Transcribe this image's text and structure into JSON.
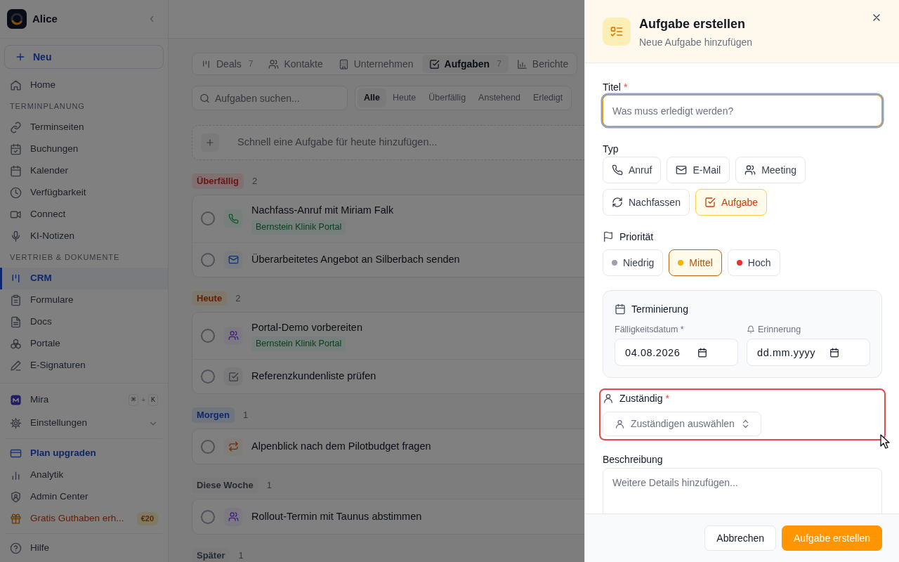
{
  "sidebar": {
    "workspace": "Alice",
    "new_button": "Neu",
    "nav": [
      {
        "kind": "home",
        "label": "Home",
        "selected": false
      },
      {
        "kind": "heading",
        "label": "TERMINPLANUNG"
      },
      {
        "kind": "link",
        "label": "Terminseiten",
        "selected": false
      },
      {
        "kind": "bookings",
        "label": "Buchungen",
        "selected": false
      },
      {
        "kind": "calendar",
        "label": "Kalender",
        "selected": false
      },
      {
        "kind": "clock",
        "label": "Verfügbarkeit",
        "selected": false
      },
      {
        "kind": "video",
        "label": "Connect",
        "selected": false
      },
      {
        "kind": "mic",
        "label": "KI-Notizen",
        "selected": false
      },
      {
        "kind": "heading",
        "label": "VERTRIEB & DOKUMENTE"
      },
      {
        "kind": "crm",
        "label": "CRM",
        "selected": true
      },
      {
        "kind": "forms",
        "label": "Formulare",
        "selected": false
      },
      {
        "kind": "docs",
        "label": "Docs",
        "selected": false
      },
      {
        "kind": "portals",
        "label": "Portale",
        "selected": false
      },
      {
        "kind": "signatures",
        "label": "E-Signaturen",
        "selected": false
      }
    ],
    "bottom_groups": [
      [
        {
          "kind": "assistant",
          "label": "Mira",
          "keys": [
            "⌘",
            "K"
          ],
          "key_joiner": "+"
        },
        {
          "kind": "expander",
          "label": "Einstellungen",
          "expanded": false
        }
      ],
      [
        {
          "kind": "accent",
          "label": "Plan upgraden"
        },
        {
          "kind": "plain",
          "label": "Analytik"
        },
        {
          "kind": "plain",
          "label": "Admin Center"
        },
        {
          "kind": "reward",
          "label": "Gratis Guthaben erh...",
          "badge": "€20"
        }
      ],
      [
        {
          "kind": "plain",
          "label": "Hilfe"
        }
      ]
    ]
  },
  "main": {
    "tabs": [
      {
        "label": "Deals",
        "count": "7",
        "selected": false
      },
      {
        "label": "Kontakte",
        "selected": false
      },
      {
        "label": "Unternehmen",
        "selected": false
      },
      {
        "label": "Aufgaben",
        "count": "7",
        "selected": true
      },
      {
        "label": "Berichte",
        "selected": false
      }
    ],
    "search": {
      "placeholder": "Aufgaben suchen..."
    },
    "filters": [
      {
        "label": "Alle",
        "selected": true
      },
      {
        "label": "Heute",
        "selected": false
      },
      {
        "label": "Überfällig",
        "selected": false
      },
      {
        "label": "Anstehend",
        "selected": false
      },
      {
        "label": "Erledigt",
        "selected": false
      }
    ],
    "quick_add": {
      "placeholder": "Schnell eine Aufgabe für heute hinzufügen..."
    },
    "groups": [
      {
        "label": "Überfällig",
        "count": "2",
        "kind": "overdue",
        "tasks": [
          {
            "title": "Nachfass-Anruf mit Miriam Falk",
            "kind": "call",
            "checked": false,
            "tag": "Bernstein Klinik Portal"
          },
          {
            "title": "Überarbeitetes Angebot an Silberbach senden",
            "kind": "email",
            "checked": false
          }
        ]
      },
      {
        "label": "Heute",
        "count": "2",
        "kind": "today",
        "tasks": [
          {
            "title": "Portal-Demo vorbereiten",
            "kind": "meeting",
            "checked": false,
            "tag": "Bernstein Klinik Portal"
          },
          {
            "title": "Referenzkundenliste prüfen",
            "kind": "task",
            "checked": false
          }
        ]
      },
      {
        "label": "Morgen",
        "count": "1",
        "kind": "tomorrow",
        "tasks": [
          {
            "title": "Alpenblick nach dem Pilotbudget fragen",
            "kind": "followup",
            "checked": false
          }
        ]
      },
      {
        "label": "Diese Woche",
        "count": "1",
        "kind": "week",
        "tasks": [
          {
            "title": "Rollout-Termin mit Taunus abstimmen",
            "kind": "meeting",
            "checked": false
          }
        ]
      },
      {
        "label": "Später",
        "count": "1",
        "kind": "later"
      }
    ]
  },
  "drawer": {
    "title": "Aufgabe erstellen",
    "subtitle": "Neue Aufgabe hinzufügen",
    "title_field": {
      "label": "Titel",
      "required_mark": "*",
      "placeholder": "Was muss erledigt werden?",
      "focused": true
    },
    "type": {
      "label": "Typ",
      "options": [
        {
          "label": "Anruf",
          "selected": false
        },
        {
          "label": "E-Mail",
          "selected": false
        },
        {
          "label": "Meeting",
          "selected": false
        },
        {
          "label": "Nachfassen",
          "selected": false
        },
        {
          "label": "Aufgabe",
          "selected": true
        }
      ]
    },
    "priority": {
      "label": "Priorität",
      "options": [
        {
          "label": "Niedrig",
          "color": "#9ca3af",
          "selected": false
        },
        {
          "label": "Mittel",
          "color": "#f5b000",
          "selected": true
        },
        {
          "label": "Hoch",
          "color": "#ef2d2d",
          "selected": false
        }
      ]
    },
    "scheduling": {
      "title": "Terminierung",
      "due": {
        "label": "Fälligkeitsdatum *",
        "value": "04.08.2026"
      },
      "reminder": {
        "label": "Erinnerung",
        "placeholder": "dd.mm.yyyy"
      }
    },
    "assignee": {
      "label": "Zuständig",
      "required_mark": "*",
      "placeholder": "Zuständigen auswählen",
      "highlighted": true
    },
    "description": {
      "label": "Beschreibung",
      "placeholder": "Weitere Details hinzufügen..."
    },
    "buttons": [
      {
        "label": "Abbrechen",
        "kind": "secondary"
      },
      {
        "label": "Aufgabe erstellen",
        "kind": "primary"
      }
    ]
  }
}
